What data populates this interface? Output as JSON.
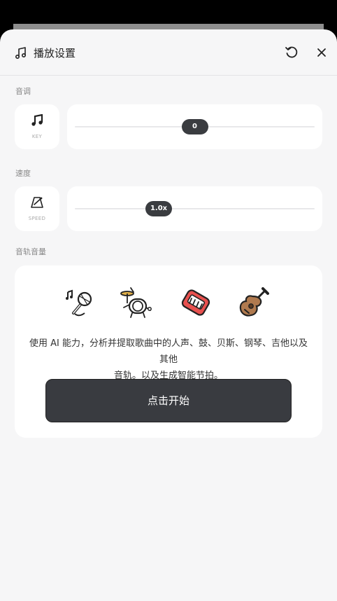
{
  "header": {
    "title": "播放设置"
  },
  "pitch": {
    "label": "音调",
    "icon_caption": "KEY",
    "value_label": "0",
    "value": 0.5
  },
  "speed": {
    "label": "速度",
    "icon_caption": "SPEED",
    "value_label": "1.0x",
    "value": 0.35
  },
  "tracks": {
    "label": "音轨音量",
    "instruments": [
      "vocal-icon",
      "drum-icon",
      "keyboard-icon",
      "guitar-icon"
    ],
    "description_line1": "使用 AI 能力，分析并提取歌曲中的人声、鼓、贝斯、钢琴、吉他以及其他",
    "description_line2": "音轨。以及生成智能节拍。",
    "start_label": "点击开始"
  },
  "colors": {
    "accent_dark": "#393b40",
    "sheet_bg": "#f6f6f7",
    "card_bg": "#ffffff",
    "instrument_red": "#e8514f",
    "instrument_wood": "#b07a4f"
  }
}
